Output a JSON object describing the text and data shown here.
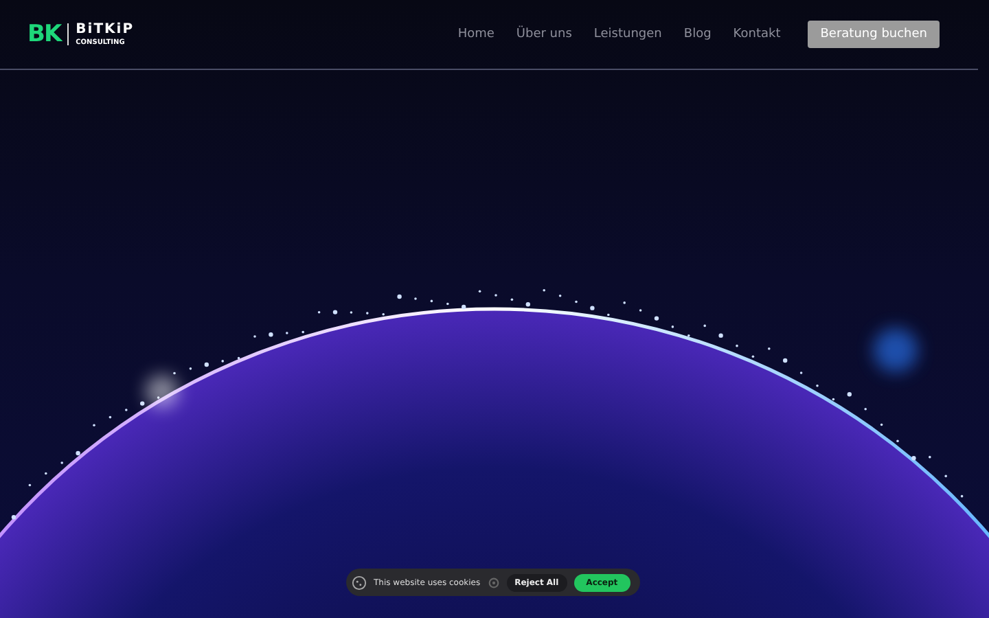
{
  "header": {
    "logo": {
      "mark": "BK",
      "name": "BiTKiP",
      "tagline": "CONSULTING"
    },
    "nav": [
      {
        "label": "Home"
      },
      {
        "label": "Über uns"
      },
      {
        "label": "Leistungen"
      },
      {
        "label": "Blog"
      },
      {
        "label": "Kontakt"
      }
    ],
    "cta": "Beratung buchen"
  },
  "cookie_banner": {
    "text": "This website uses cookies",
    "reject": "Reject All",
    "accept": "Accept"
  }
}
